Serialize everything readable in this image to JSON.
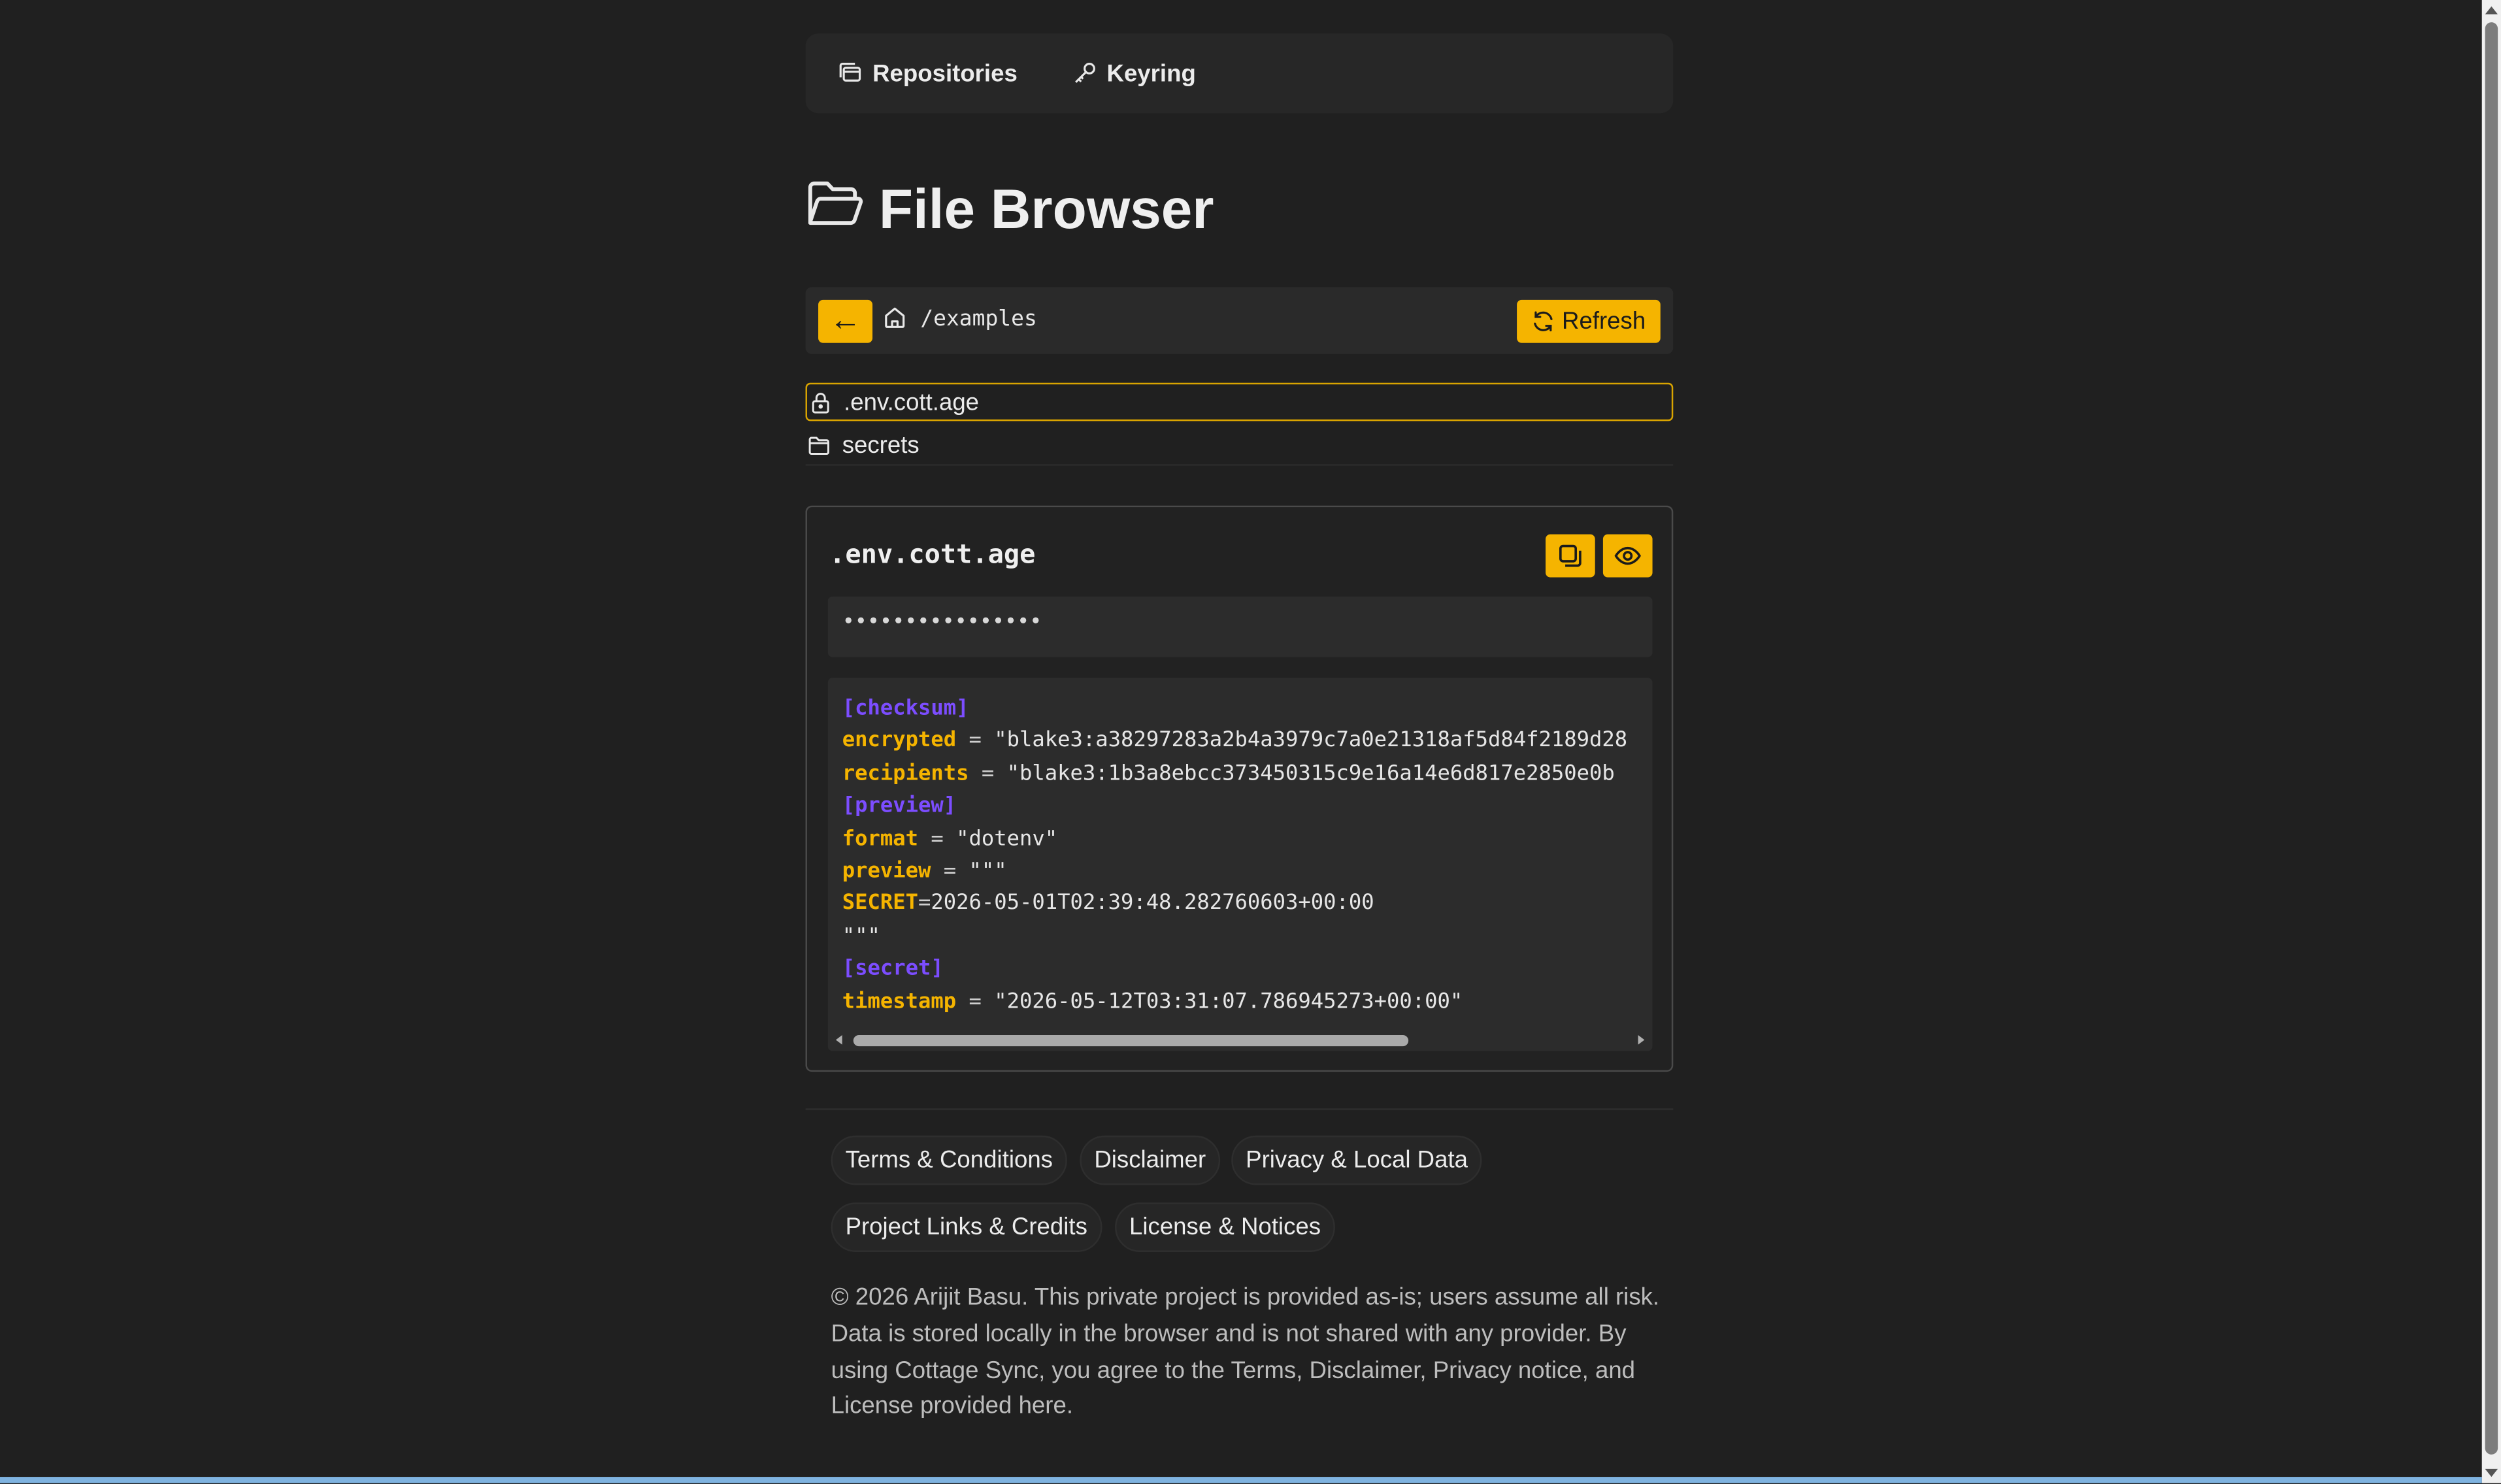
{
  "nav": {
    "items": [
      {
        "label": "Repositories",
        "icon": "stack-icon"
      },
      {
        "label": "Keyring",
        "icon": "key-icon"
      }
    ]
  },
  "page": {
    "title": "File Browser",
    "title_icon": "folder-open-icon"
  },
  "pathbar": {
    "back_label": "←",
    "path": "/examples",
    "refresh_label": "Refresh"
  },
  "files": [
    {
      "name": ".env.cott.age",
      "icon": "lock-icon",
      "selected": true
    },
    {
      "name": "secrets",
      "icon": "folder-icon",
      "selected": false
    }
  ],
  "viewer": {
    "filename": ".env.cott.age",
    "masked_value": "••••••••••••••••",
    "code": [
      [
        {
          "t": "[checksum]",
          "c": "sec"
        }
      ],
      [
        {
          "t": "encrypted",
          "c": "key"
        },
        {
          "t": " = ",
          "c": "eq"
        },
        {
          "t": "\"blake3:a38297283a2b4a3979c7a0e21318af5d84f2189d28",
          "c": "str"
        }
      ],
      [
        {
          "t": "recipients",
          "c": "key"
        },
        {
          "t": " = ",
          "c": "eq"
        },
        {
          "t": "\"blake3:1b3a8ebcc373450315c9e16a14e6d817e2850e0b",
          "c": "str"
        }
      ],
      [
        {
          "t": "[preview]",
          "c": "sec"
        }
      ],
      [
        {
          "t": "format",
          "c": "key"
        },
        {
          "t": " = ",
          "c": "eq"
        },
        {
          "t": "\"dotenv\"",
          "c": "str"
        }
      ],
      [
        {
          "t": "preview",
          "c": "key"
        },
        {
          "t": " = ",
          "c": "eq"
        },
        {
          "t": "\"\"\"",
          "c": "str"
        }
      ],
      [
        {
          "t": "SECRET",
          "c": "key"
        },
        {
          "t": "=",
          "c": "eq"
        },
        {
          "t": "2026-05-01T02:39:48.282760603+00:00",
          "c": "str"
        }
      ],
      [
        {
          "t": "\"\"\"",
          "c": "str"
        }
      ],
      [
        {
          "t": "[secret]",
          "c": "sec"
        }
      ],
      [
        {
          "t": "timestamp",
          "c": "key"
        },
        {
          "t": " = ",
          "c": "eq"
        },
        {
          "t": "\"2026-05-12T03:31:07.786945273+00:00\"",
          "c": "str"
        }
      ]
    ]
  },
  "footer": {
    "links": [
      "Terms & Conditions",
      "Disclaimer",
      "Privacy & Local Data",
      "Project Links & Credits",
      "License & Notices"
    ],
    "copyright": "© 2026 Arijit Basu. This private project is provided as-is; users assume all risk. Data is stored locally in the browser and is not shared with any provider. By using Cottage Sync, you agree to the Terms, Disclaimer, Privacy notice, and License provided here."
  },
  "colors": {
    "background": "#202020",
    "accent": "#f5b400",
    "section": "#7c4dff",
    "key": "#f5b400"
  }
}
